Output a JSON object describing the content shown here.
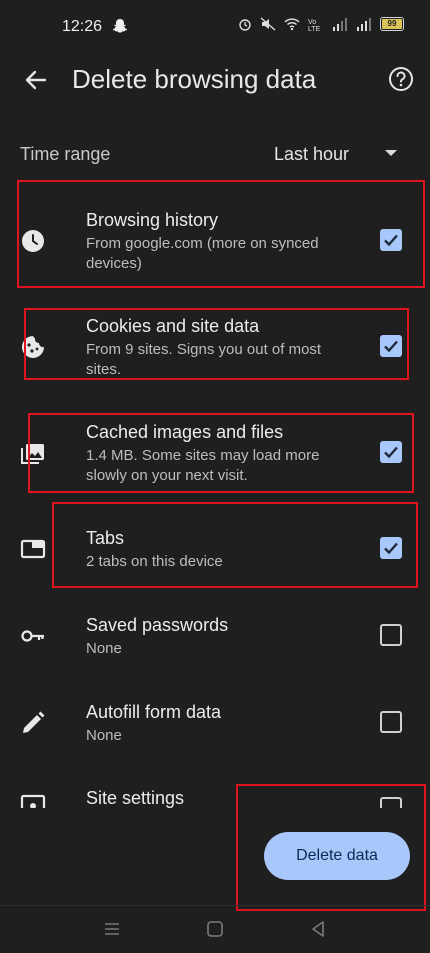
{
  "status_bar": {
    "time": "12:26",
    "battery": "99"
  },
  "header": {
    "title": "Delete browsing data"
  },
  "time_range": {
    "label": "Time range",
    "value": "Last hour"
  },
  "items": [
    {
      "label": "Browsing history",
      "desc": "From google.com (more on synced devices)",
      "checked": true,
      "icon": "clock-icon"
    },
    {
      "label": "Cookies and site data",
      "desc": "From 9 sites. Signs you out of most sites.",
      "checked": true,
      "icon": "cookie-icon"
    },
    {
      "label": "Cached images and files",
      "desc": "1.4 MB. Some sites may load more slowly on your next visit.",
      "checked": true,
      "icon": "image-icon"
    },
    {
      "label": "Tabs",
      "desc": "2 tabs on this device",
      "checked": true,
      "icon": "tab-icon"
    },
    {
      "label": "Saved passwords",
      "desc": "None",
      "checked": false,
      "icon": "key-icon"
    },
    {
      "label": "Autofill form data",
      "desc": "None",
      "checked": false,
      "icon": "pencil-icon"
    },
    {
      "label": "Site settings",
      "desc": "",
      "checked": false,
      "icon": "site-settings-icon"
    }
  ],
  "action": {
    "delete_label": "Delete data"
  },
  "colors": {
    "accent": "#a8c7fa",
    "background": "#1f1f1f",
    "annotation": "#e0141e"
  }
}
